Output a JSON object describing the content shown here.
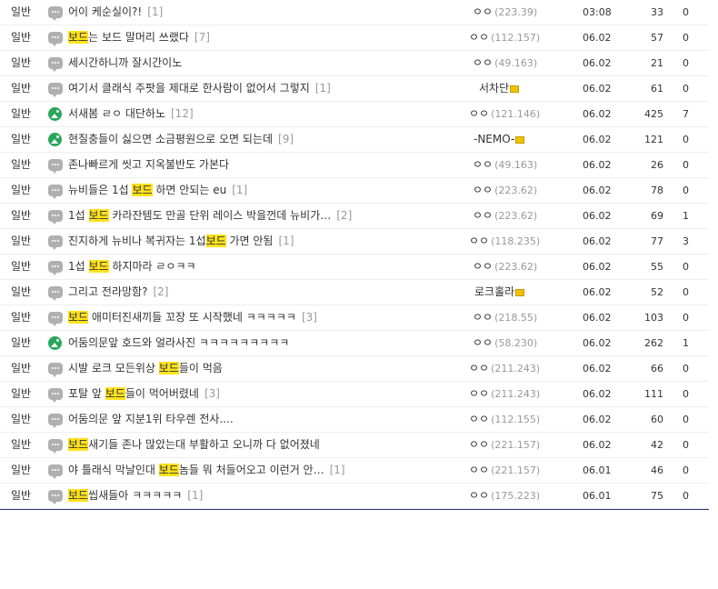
{
  "board": {
    "rows": [
      {
        "category": "일반",
        "icon": "chat",
        "parts": [
          {
            "t": "어이 케순실이?!",
            "h": false
          }
        ],
        "reply": "[1]",
        "writer": "ㅇㅇ",
        "ip": "(223.39)",
        "date": "03:08",
        "views": "33",
        "votes": "0"
      },
      {
        "category": "일반",
        "icon": "chat",
        "parts": [
          {
            "t": "보드",
            "h": true
          },
          {
            "t": "는 보드 말머리 쓰랬다",
            "h": false
          }
        ],
        "reply": "[7]",
        "writer": "ㅇㅇ",
        "ip": "(112.157)",
        "date": "06.02",
        "views": "57",
        "votes": "0"
      },
      {
        "category": "일반",
        "icon": "chat",
        "parts": [
          {
            "t": "세시간하니까 잘시간이노",
            "h": false
          }
        ],
        "reply": "",
        "writer": "ㅇㅇ",
        "ip": "(49.163)",
        "date": "06.02",
        "views": "21",
        "votes": "0"
      },
      {
        "category": "일반",
        "icon": "chat",
        "parts": [
          {
            "t": "여기서 클래식 주팟을 제대로 한사람이 없어서 그렇지",
            "h": false
          }
        ],
        "reply": "[1]",
        "writer": "서차단",
        "ip": "",
        "lock": true,
        "date": "06.02",
        "views": "61",
        "votes": "0"
      },
      {
        "category": "일반",
        "icon": "img",
        "parts": [
          {
            "t": "서새봄 ㄹㅇ 대단하노",
            "h": false
          }
        ],
        "reply": "[12]",
        "writer": "ㅇㅇ",
        "ip": "(121.146)",
        "date": "06.02",
        "views": "425",
        "votes": "7"
      },
      {
        "category": "일반",
        "icon": "img",
        "parts": [
          {
            "t": "현질충들이 싫으면 소금평원으로 오면 되는데",
            "h": false
          }
        ],
        "reply": "[9]",
        "writer": "-NEMO-",
        "ip": "",
        "lock": true,
        "date": "06.02",
        "views": "121",
        "votes": "0"
      },
      {
        "category": "일반",
        "icon": "chat",
        "parts": [
          {
            "t": "존나빠르게 씻고 지옥불반도 가본다",
            "h": false
          }
        ],
        "reply": "",
        "writer": "ㅇㅇ",
        "ip": "(49.163)",
        "date": "06.02",
        "views": "26",
        "votes": "0"
      },
      {
        "category": "일반",
        "icon": "chat",
        "parts": [
          {
            "t": "뉴비들은 1섭 ",
            "h": false
          },
          {
            "t": "보드",
            "h": true
          },
          {
            "t": " 하면 안되는 eu",
            "h": false
          }
        ],
        "reply": "[1]",
        "writer": "ㅇㅇ",
        "ip": "(223.62)",
        "date": "06.02",
        "views": "78",
        "votes": "0"
      },
      {
        "category": "일반",
        "icon": "chat",
        "parts": [
          {
            "t": "1섭 ",
            "h": false
          },
          {
            "t": "보드",
            "h": true
          },
          {
            "t": " 카라잔템도 만골 단위 레이스 박을껀데 뉴비가…",
            "h": false
          }
        ],
        "reply": "[2]",
        "writer": "ㅇㅇ",
        "ip": "(223.62)",
        "date": "06.02",
        "views": "69",
        "votes": "1"
      },
      {
        "category": "일반",
        "icon": "chat",
        "parts": [
          {
            "t": "진지하게 뉴비나 복귀자는 1섭",
            "h": false
          },
          {
            "t": "보드",
            "h": true
          },
          {
            "t": " 가면 안됨",
            "h": false
          }
        ],
        "reply": "[1]",
        "writer": "ㅇㅇ",
        "ip": "(118.235)",
        "date": "06.02",
        "views": "77",
        "votes": "3"
      },
      {
        "category": "일반",
        "icon": "chat",
        "parts": [
          {
            "t": "1섭 ",
            "h": false
          },
          {
            "t": "보드",
            "h": true
          },
          {
            "t": " 하지마라 ㄹㅇㅋㅋ",
            "h": false
          }
        ],
        "reply": "",
        "writer": "ㅇㅇ",
        "ip": "(223.62)",
        "date": "06.02",
        "views": "55",
        "votes": "0"
      },
      {
        "category": "일반",
        "icon": "chat",
        "parts": [
          {
            "t": "그리고 전라망함?",
            "h": false
          }
        ],
        "reply": "[2]",
        "writer": "로크홀라",
        "ip": "",
        "lock": true,
        "date": "06.02",
        "views": "52",
        "votes": "0"
      },
      {
        "category": "일반",
        "icon": "chat",
        "parts": [
          {
            "t": "보드",
            "h": true
          },
          {
            "t": " 애미터진새끼들 꼬장 또 시작했네 ㅋㅋㅋㅋㅋ",
            "h": false
          }
        ],
        "reply": "[3]",
        "writer": "ㅇㅇ",
        "ip": "(218.55)",
        "date": "06.02",
        "views": "103",
        "votes": "0"
      },
      {
        "category": "일반",
        "icon": "img",
        "parts": [
          {
            "t": "어둠의문앞 호드와 얼라사진 ㅋㅋㅋㅋㅋㅋㅋㅋㅋ",
            "h": false
          }
        ],
        "reply": "",
        "writer": "ㅇㅇ",
        "ip": "(58.230)",
        "date": "06.02",
        "views": "262",
        "votes": "1"
      },
      {
        "category": "일반",
        "icon": "chat",
        "parts": [
          {
            "t": "시발 로크 모든위상 ",
            "h": false
          },
          {
            "t": "보드",
            "h": true
          },
          {
            "t": "들이 먹음",
            "h": false
          }
        ],
        "reply": "",
        "writer": "ㅇㅇ",
        "ip": "(211.243)",
        "date": "06.02",
        "views": "66",
        "votes": "0"
      },
      {
        "category": "일반",
        "icon": "chat",
        "parts": [
          {
            "t": "포탈 앞 ",
            "h": false
          },
          {
            "t": "보드",
            "h": true
          },
          {
            "t": "들이 먹어버렸네",
            "h": false
          }
        ],
        "reply": "[3]",
        "writer": "ㅇㅇ",
        "ip": "(211.243)",
        "date": "06.02",
        "views": "111",
        "votes": "0"
      },
      {
        "category": "일반",
        "icon": "chat",
        "parts": [
          {
            "t": "어둠의문 앞 지분1위 타우렌 전사....",
            "h": false
          }
        ],
        "reply": "",
        "writer": "ㅇㅇ",
        "ip": "(112.155)",
        "date": "06.02",
        "views": "60",
        "votes": "0"
      },
      {
        "category": "일반",
        "icon": "chat",
        "parts": [
          {
            "t": "보드",
            "h": true
          },
          {
            "t": "새기들 존나 많았는대 부활하고 오니까 다 없어졌네",
            "h": false
          }
        ],
        "reply": "",
        "writer": "ㅇㅇ",
        "ip": "(221.157)",
        "date": "06.02",
        "views": "42",
        "votes": "0"
      },
      {
        "category": "일반",
        "icon": "chat",
        "parts": [
          {
            "t": "야 틀래식 막날인대 ",
            "h": false
          },
          {
            "t": "보드",
            "h": true
          },
          {
            "t": "놈들 뭐 처들어오고 이런거 안…",
            "h": false
          }
        ],
        "reply": "[1]",
        "writer": "ㅇㅇ",
        "ip": "(221.157)",
        "date": "06.01",
        "views": "46",
        "votes": "0"
      },
      {
        "category": "일반",
        "icon": "chat",
        "parts": [
          {
            "t": "보드",
            "h": true
          },
          {
            "t": "씹새들아 ㅋㅋㅋㅋㅋ",
            "h": false
          }
        ],
        "reply": "[1]",
        "writer": "ㅇㅇ",
        "ip": "(175.223)",
        "date": "06.01",
        "views": "75",
        "votes": "0"
      }
    ]
  }
}
